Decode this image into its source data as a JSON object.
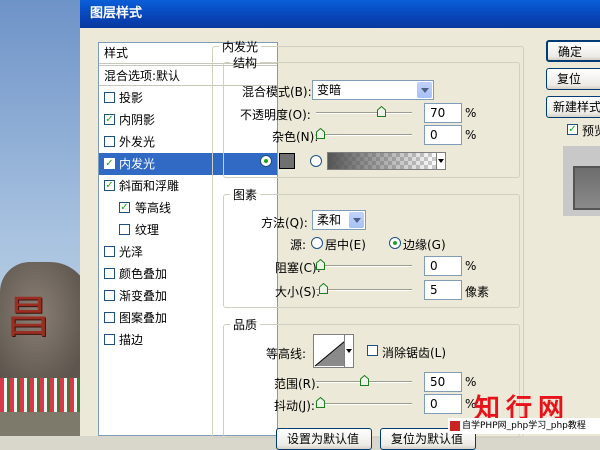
{
  "dialog": {
    "title": "图层样式"
  },
  "styles_panel": {
    "header": "样式",
    "blend_options": "混合选项:默认",
    "items": [
      {
        "label": "投影",
        "checked": false,
        "selected": false,
        "indent": false
      },
      {
        "label": "内阴影",
        "checked": true,
        "selected": false,
        "indent": false
      },
      {
        "label": "外发光",
        "checked": false,
        "selected": false,
        "indent": false
      },
      {
        "label": "内发光",
        "checked": true,
        "selected": true,
        "indent": false
      },
      {
        "label": "斜面和浮雕",
        "checked": true,
        "selected": false,
        "indent": false
      },
      {
        "label": "等高线",
        "checked": true,
        "selected": false,
        "indent": true
      },
      {
        "label": "纹理",
        "checked": false,
        "selected": false,
        "indent": true
      },
      {
        "label": "光泽",
        "checked": false,
        "selected": false,
        "indent": false
      },
      {
        "label": "颜色叠加",
        "checked": false,
        "selected": false,
        "indent": false
      },
      {
        "label": "渐变叠加",
        "checked": false,
        "selected": false,
        "indent": false
      },
      {
        "label": "图案叠加",
        "checked": false,
        "selected": false,
        "indent": false
      },
      {
        "label": "描边",
        "checked": false,
        "selected": false,
        "indent": false
      }
    ]
  },
  "inner_glow": {
    "title": "内发光",
    "structure": {
      "title": "结构",
      "blend_mode_label": "混合模式(B):",
      "blend_mode_value": "变暗",
      "opacity_label": "不透明度(O):",
      "opacity_value": "70",
      "opacity_level": 70,
      "noise_label": "杂色(N):",
      "noise_value": "0",
      "noise_level": 0,
      "percent": "%",
      "color_mode": "solid",
      "swatch_color": "#707070"
    },
    "elements": {
      "title": "图素",
      "technique_label": "方法(Q):",
      "technique_value": "柔和",
      "source_label": "源:",
      "source_center": "居中(E)",
      "source_edge": "边缘(G)",
      "source_selected": "edge",
      "choke_label": "阻塞(C):",
      "choke_value": "0",
      "choke_level": 0,
      "size_label": "大小(S):",
      "size_value": "5",
      "size_unit": "像素",
      "percent": "%"
    },
    "quality": {
      "title": "品质",
      "contour_label": "等高线:",
      "antialias_label": "消除锯齿(L)",
      "antialias_checked": false,
      "range_label": "范围(R):",
      "range_value": "50",
      "range_level": 50,
      "jitter_label": "抖动(J):",
      "jitter_value": "0",
      "jitter_level": 0,
      "percent": "%"
    }
  },
  "buttons": {
    "ok": "确定",
    "reset": "复位",
    "new_style": "新建样式...",
    "preview_label": "预览(V)",
    "preview_checked": true,
    "make_default": "设置为默认值",
    "reset_default": "复位为默认值"
  },
  "background_sign": {
    "char": "昌"
  },
  "watermark": {
    "logo": "知行网",
    "caption": "自学PHP网_php学习_php教程"
  }
}
